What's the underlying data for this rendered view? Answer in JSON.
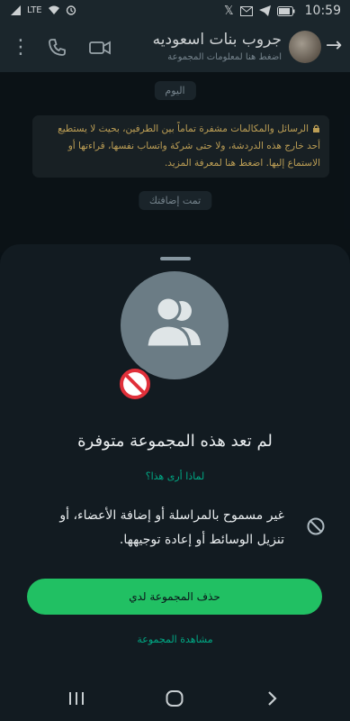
{
  "status_bar": {
    "time": "10:59",
    "network_label": "LTE",
    "icons": [
      "signal-icon",
      "wifi-icon",
      "alarm-icon",
      "x-icon",
      "gmail-icon",
      "telegram-icon",
      "battery-icon"
    ]
  },
  "header": {
    "title": "جروب بنات اسعوديه",
    "subtitle": "اضغط هنا لمعلومات المجموعة",
    "icons": [
      "back-arrow-icon",
      "phone-icon",
      "video-icon",
      "more-icon"
    ]
  },
  "chat": {
    "date_chip": "اليوم",
    "encryption_notice": "الرسائل والمكالمات مشفرة تماماً بين الطرفين، بحيث لا يستطيع أحد خارج هذه الدردشة، ولا حتى شركة واتساب نفسها، قراءتها أو الاستماع إليها. اضغط هنا لمعرفة المزيد.",
    "added_chip": "تمت إضافتك"
  },
  "sheet": {
    "title": "لم تعد هذه المجموعة متوفرة",
    "why_link": "لماذا أرى هذا؟",
    "notice": "غير مسموح بالمراسلة أو إضافة الأعضاء، أو تنزيل الوسائط أو إعادة توجيهها.",
    "delete_button": "حذف المجموعة لدي",
    "view_link": "مشاهدة المجموعة"
  },
  "colors": {
    "accent": "#21c063",
    "link": "#00a884",
    "encryption_text": "#d6b461",
    "background": "#0b141a",
    "header": "#1f2c33"
  }
}
